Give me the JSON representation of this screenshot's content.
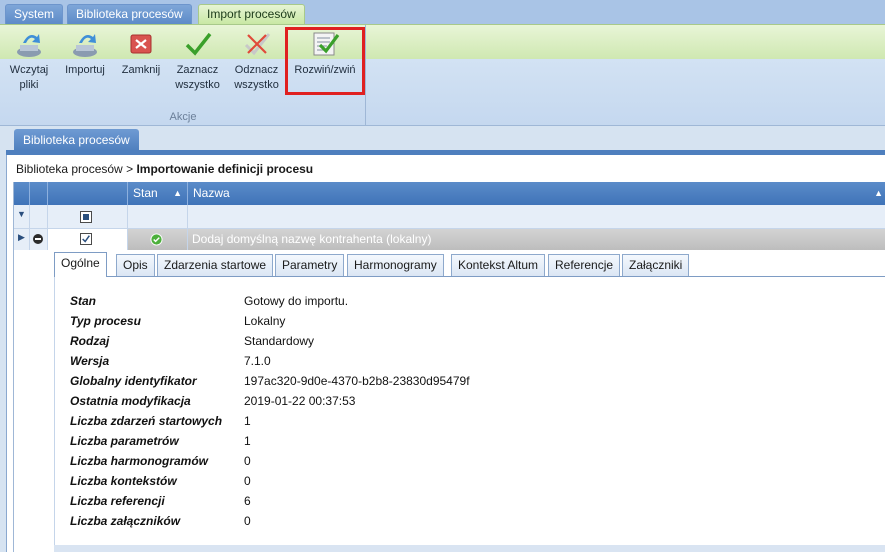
{
  "ribbon_tabs": [
    {
      "label": "System"
    },
    {
      "label": "Biblioteka procesów"
    },
    {
      "label": "Import procesów"
    }
  ],
  "ribbon": {
    "buttons": [
      {
        "label": "Wczytaj pliki",
        "icon": "load-files-icon"
      },
      {
        "label": "Importuj",
        "icon": "import-icon"
      },
      {
        "label": "Zamknij",
        "icon": "close-icon"
      },
      {
        "label": "Zaznacz wszystko",
        "icon": "check-icon"
      },
      {
        "label": "Odznacz wszystko",
        "icon": "uncheck-icon"
      },
      {
        "label": "Rozwiń/zwiń",
        "icon": "expand-collapse-icon"
      }
    ],
    "group_label": "Akcje"
  },
  "document_tab": "Biblioteka procesów",
  "breadcrumb": {
    "root": "Biblioteka procesów",
    "separator": ">",
    "current": "Importowanie definicji procesu"
  },
  "grid": {
    "columns": [
      {
        "label": "Stan"
      },
      {
        "label": "Nazwa"
      }
    ],
    "row": {
      "name": "Dodaj domyślną nazwę kontrahenta (lokalny)",
      "checked": true,
      "status": "ok"
    }
  },
  "detail_tabs": [
    {
      "label": "Ogólne"
    },
    {
      "label": "Opis"
    },
    {
      "label": "Zdarzenia startowe"
    },
    {
      "label": "Parametry"
    },
    {
      "label": "Harmonogramy"
    },
    {
      "label": "Kontekst Altum"
    },
    {
      "label": "Referencje"
    },
    {
      "label": "Załączniki"
    }
  ],
  "properties": [
    {
      "label": "Stan",
      "value": "Gotowy do importu."
    },
    {
      "label": "Typ procesu",
      "value": "Lokalny"
    },
    {
      "label": "Rodzaj",
      "value": "Standardowy"
    },
    {
      "label": "Wersja",
      "value": "7.1.0"
    },
    {
      "label": "Globalny identyfikator",
      "value": "197ac320-9d0e-4370-b2b8-23830d95479f"
    },
    {
      "label": "Ostatnia modyfikacja",
      "value": "2019-01-22 00:37:53"
    },
    {
      "label": "Liczba zdarzeń startowych",
      "value": "1"
    },
    {
      "label": "Liczba parametrów",
      "value": "1"
    },
    {
      "label": "Liczba harmonogramów",
      "value": "0"
    },
    {
      "label": "Liczba kontekstów",
      "value": "0"
    },
    {
      "label": "Liczba referencji",
      "value": "6"
    },
    {
      "label": "Liczba załączników",
      "value": "0"
    }
  ],
  "colors": {
    "highlight": "#e02020",
    "header": "#4a7fc0",
    "accent_green": "#3aa02a"
  }
}
